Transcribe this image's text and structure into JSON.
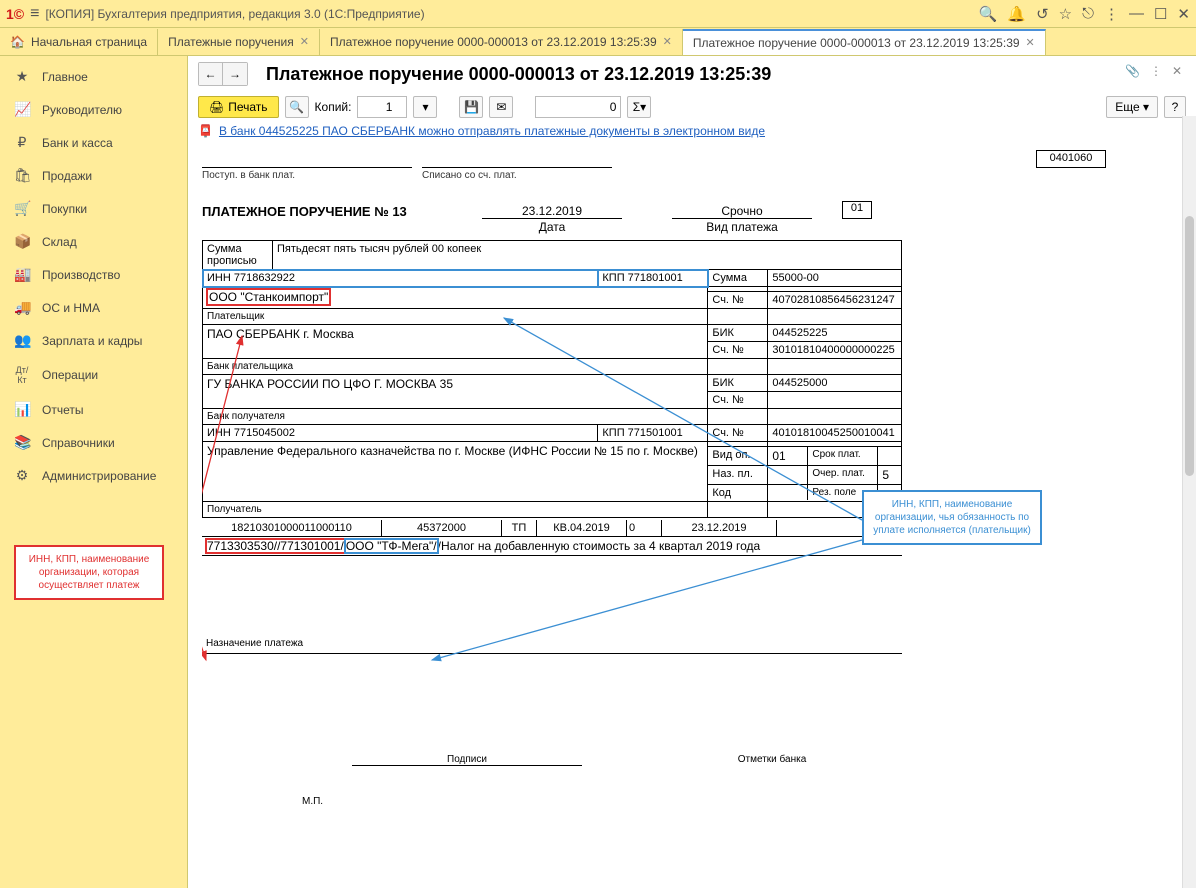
{
  "app": {
    "title": "[КОПИЯ] Бухгалтерия предприятия, редакция 3.0  (1С:Предприятие)"
  },
  "tabs": {
    "home": "Начальная страница",
    "t1": "Платежные поручения",
    "t2": "Платежное поручение 0000-000013 от 23.12.2019 13:25:39",
    "t3": "Платежное поручение 0000-000013 от 23.12.2019 13:25:39"
  },
  "sidebar": {
    "items": [
      {
        "icon": "★",
        "label": "Главное"
      },
      {
        "icon": "📈",
        "label": "Руководителю"
      },
      {
        "icon": "₽",
        "label": "Банк и касса"
      },
      {
        "icon": "🛍",
        "label": "Продажи"
      },
      {
        "icon": "🛒",
        "label": "Покупки"
      },
      {
        "icon": "📦",
        "label": "Склад"
      },
      {
        "icon": "🏭",
        "label": "Производство"
      },
      {
        "icon": "🚚",
        "label": "ОС и НМА"
      },
      {
        "icon": "👥",
        "label": "Зарплата и кадры"
      },
      {
        "icon": "Дт/Кт",
        "label": "Операции"
      },
      {
        "icon": "📊",
        "label": "Отчеты"
      },
      {
        "icon": "📚",
        "label": "Справочники"
      },
      {
        "icon": "⚙",
        "label": "Администрирование"
      }
    ]
  },
  "doc": {
    "title": "Платежное поручение 0000-000013 от 23.12.2019 13:25:39",
    "print": "Печать",
    "copies_label": "Копий:",
    "copies": "1",
    "sum_val": "0",
    "more": "Еще",
    "help": "?",
    "link": "В банк 044525225 ПАО СБЕРБАНК можно отправлять платежные документы в электронном виде",
    "code": "0401060",
    "postup": "Поступ. в банк плат.",
    "spisano": "Списано со сч. плат.",
    "po_title": "ПЛАТЕЖНОЕ ПОРУЧЕНИЕ № 13",
    "date": "23.12.2019",
    "date_lbl": "Дата",
    "kind": "Срочно",
    "kind_lbl": "Вид платежа",
    "num": "01",
    "sum_words_lbl": "Сумма прописью",
    "sum_words": "Пятьдесят пять тысяч рублей 00 копеек",
    "inn1": "ИНН 7718632922",
    "kpp1": "КПП 771801001",
    "sum_lbl": "Сумма",
    "sum": "55000-00",
    "org1": "ООО \"Станкоимпорт\"",
    "sch_lbl": "Сч. №",
    "sch1": "40702810856456231247",
    "payer_lbl": "Плательщик",
    "bank1": "ПАО СБЕРБАНК г. Москва",
    "bik_lbl": "БИК",
    "bik1": "044525225",
    "sch2": "30101810400000000225",
    "bank_payer_lbl": "Банк плательщика",
    "bank2": "ГУ БАНКА РОССИИ ПО ЦФО Г. МОСКВА 35",
    "bik2": "044525000",
    "bank_recv_lbl": "Банк получателя",
    "inn2": "ИНН 7715045002",
    "kpp2": "КПП 771501001",
    "sch3": "40101810045250010041",
    "org2": "Управление Федерального казначейства по г. Москве (ИФНС России № 15 по г. Москве)",
    "vid_op_lbl": "Вид оп.",
    "vid_op": "01",
    "srok_lbl": "Срок плат.",
    "naz_pl_lbl": "Наз. пл.",
    "ocher_lbl": "Очер. плат.",
    "ocher": "5",
    "kod_lbl": "Код",
    "rez_lbl": "Рез. поле",
    "recv_lbl": "Получатель",
    "b1": "18210301000011000110",
    "b2": "45372000",
    "b3": "ТП",
    "b4": "КВ.04.2019",
    "b5": "0",
    "b6": "23.12.2019",
    "b7": "",
    "purp_combined": "7713303530//771301001/ООО \"ТФ-Мега\"//Налог на добавленную стоимость за 4 квартал 2019 года",
    "purp_id": "7713303530//771301001/",
    "purp_org": "ООО \"ТФ-Мега\"/",
    "purp_rest": "/Налог на добавленную стоимость за 4 квартал 2019 года",
    "purp_lbl": "Назначение платежа",
    "sig": "Подписи",
    "stamp": "Отметки банка",
    "mp": "М.П."
  },
  "callouts": {
    "red": "ИНН, КПП, наименование организации, которая осуществляет платеж",
    "blue": "ИНН, КПП, наименование организации, чья обязанность по уплате исполняется (плательщик)"
  }
}
